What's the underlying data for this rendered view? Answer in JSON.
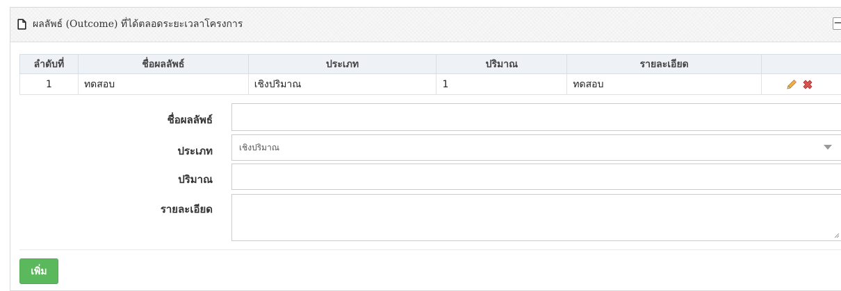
{
  "panel": {
    "title": "ผลลัพธ์ (Outcome) ที่ได้ตลอดระยะเวลาโครงการ",
    "collapse_label": "−"
  },
  "table": {
    "headers": [
      "ลำดับที่",
      "ชื่อผลลัพธ์",
      "ประเภท",
      "ปริมาณ",
      "รายละเอียด",
      ""
    ],
    "rows": [
      {
        "no": "1",
        "name": "ทดสอบ",
        "type": "เชิงปริมาณ",
        "amount": "1",
        "detail": "ทดสอบ"
      }
    ]
  },
  "form": {
    "name_label": "ชื่อผลลัพธ์",
    "name_value": "",
    "type_label": "ประเภท",
    "type_selected": "เชิงปริมาณ",
    "amount_label": "ปริมาณ",
    "amount_value": "",
    "detail_label": "รายละเอียด",
    "detail_value": ""
  },
  "add_button_label": "เพิ่ม",
  "icons": [
    "document-icon",
    "pencil-edit-icon",
    "delete-x-icon",
    "chevron-down-icon"
  ],
  "colors": {
    "add_button": "#5cb85c",
    "delete_icon": "#d9534f",
    "edit_icon": "#f0ad4e",
    "table_header": "#eef2f7"
  }
}
